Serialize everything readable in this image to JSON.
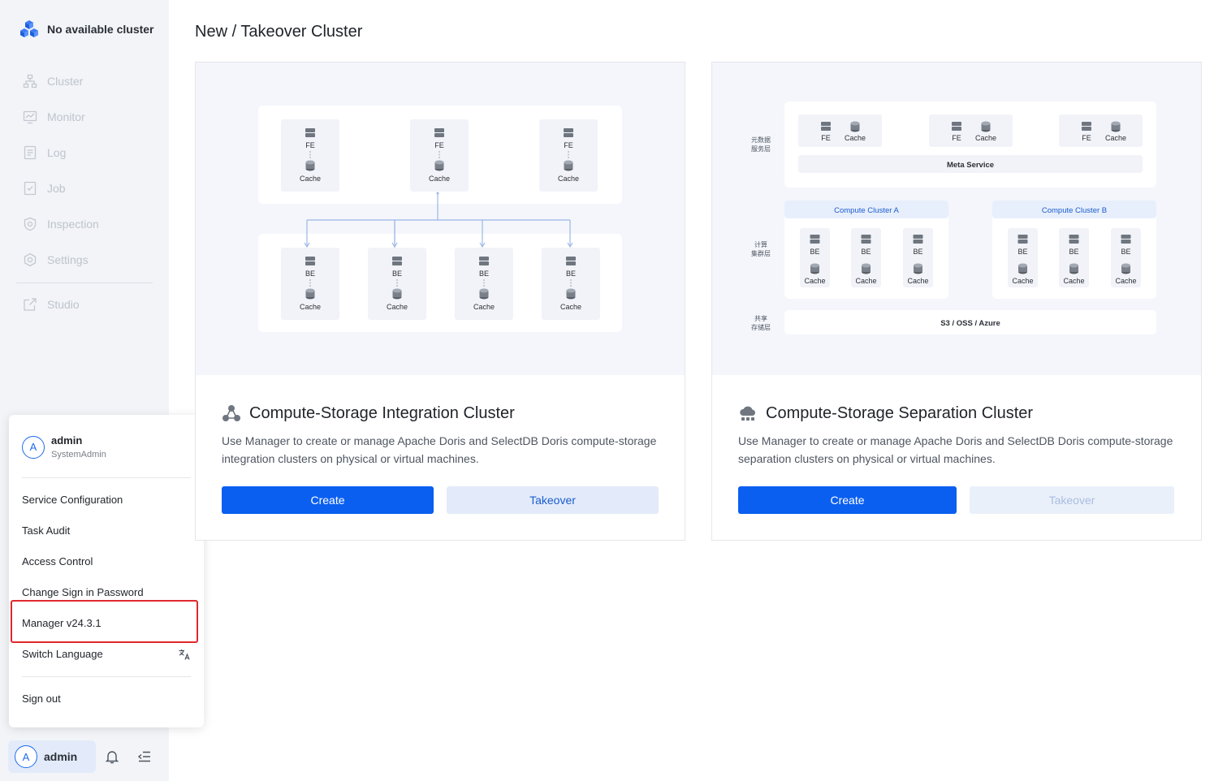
{
  "sidebar": {
    "brand": "No available cluster",
    "nav": [
      {
        "label": "Cluster",
        "icon": "cluster-icon"
      },
      {
        "label": "Monitor",
        "icon": "monitor-icon"
      },
      {
        "label": "Log",
        "icon": "log-icon"
      },
      {
        "label": "Job",
        "icon": "job-icon"
      },
      {
        "label": "Inspection",
        "icon": "inspection-icon"
      },
      {
        "label": "Settings",
        "icon": "settings-icon"
      }
    ],
    "studio": {
      "label": "Studio",
      "icon": "external-link-icon"
    }
  },
  "user_menu": {
    "avatar_letter": "A",
    "name": "admin",
    "role": "SystemAdmin",
    "items": [
      "Service Configuration",
      "Task Audit",
      "Access Control",
      "Change Sign in Password",
      "Manager v24.3.1",
      "Switch Language"
    ],
    "sign_out": "Sign out"
  },
  "bottom_bar": {
    "avatar_letter": "A",
    "user": "admin"
  },
  "page_title": "New / Takeover Cluster",
  "cards": [
    {
      "title": "Compute-Storage Integration Cluster",
      "description": "Use Manager to create or manage Apache Doris and SelectDB Doris compute-storage integration clusters on physical or virtual machines.",
      "create_label": "Create",
      "takeover_label": "Takeover",
      "diagram": {
        "fe_label": "FE",
        "be_label": "BE",
        "cache_label": "Cache"
      }
    },
    {
      "title": "Compute-Storage Separation Cluster",
      "description": "Use Manager to create or manage Apache Doris and SelectDB Doris compute-storage separation clusters on physical or virtual machines.",
      "create_label": "Create",
      "takeover_label": "Takeover",
      "diagram": {
        "meta_layer_label_1": "元数据",
        "meta_layer_label_2": "服务层",
        "compute_layer_label_1": "计算",
        "compute_layer_label_2": "集群层",
        "storage_layer_label_1": "共享",
        "storage_layer_label_2": "存储层",
        "fe_label": "FE",
        "be_label": "BE",
        "cache_label": "Cache",
        "meta_service": "Meta Service",
        "compute_a": "Compute Cluster A",
        "compute_b": "Compute Cluster B",
        "storage": "S3 / OSS / Azure"
      }
    }
  ],
  "colors": {
    "primary": "#0b5ff0",
    "highlight": "#e0282e",
    "sidebar_bg": "#f2f4f8"
  }
}
